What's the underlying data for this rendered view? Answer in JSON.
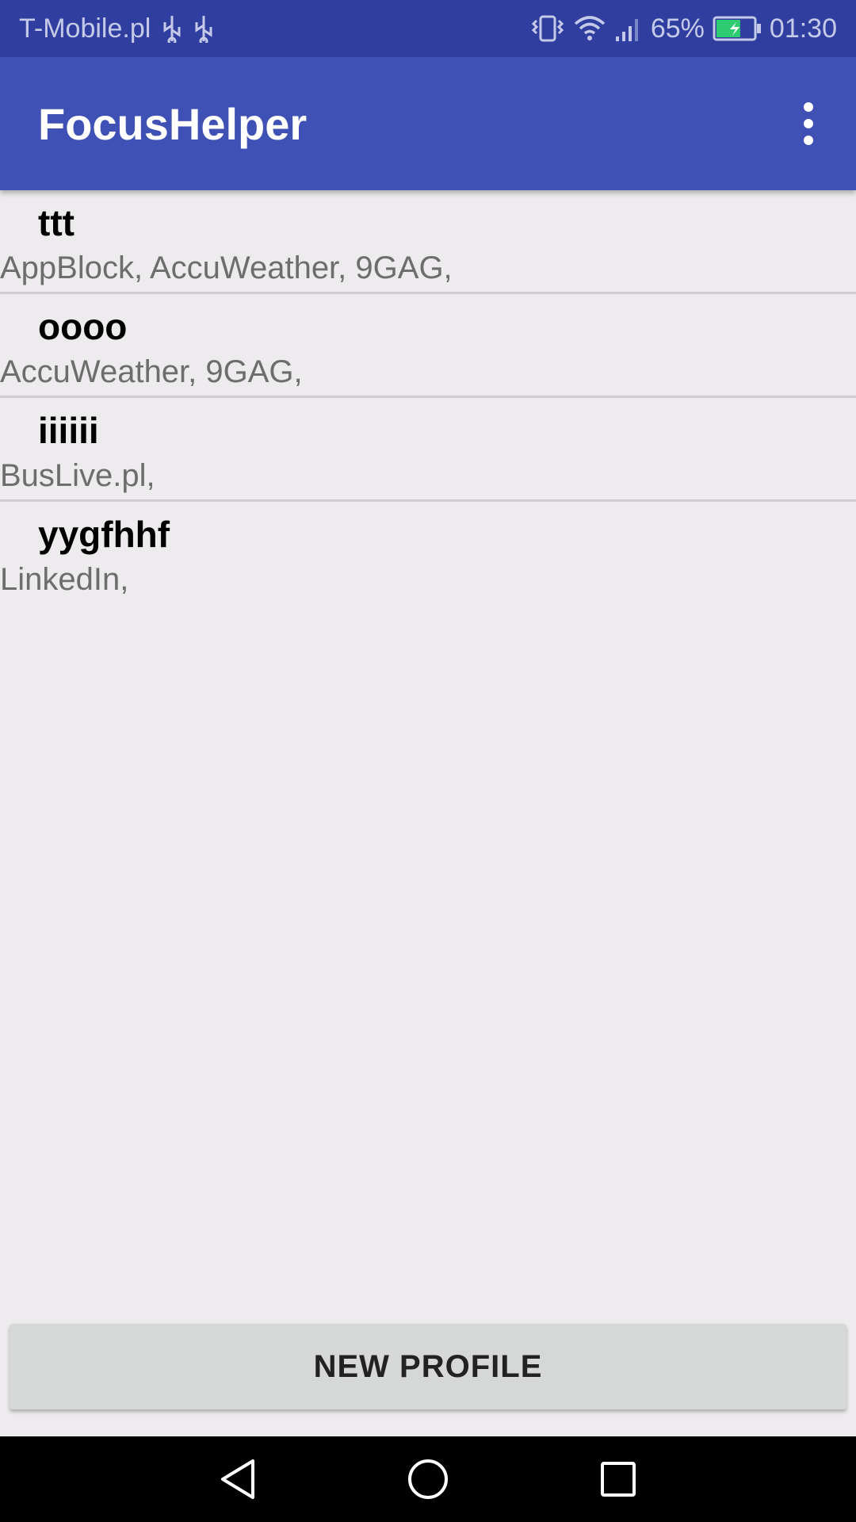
{
  "status_bar": {
    "carrier": "T-Mobile.pl",
    "battery_percent": "65%",
    "time": "01:30",
    "icons": [
      "usb-icon",
      "usb-icon",
      "vibrate-icon",
      "wifi-icon",
      "signal-icon",
      "battery-charging-icon"
    ],
    "battery_level": 0.65
  },
  "app_bar": {
    "title": "FocusHelper",
    "menu_icon": "more-vert-icon"
  },
  "profiles": [
    {
      "name": "ttt",
      "apps": "AppBlock, AccuWeather, 9GAG,"
    },
    {
      "name": "oooo",
      "apps": "AccuWeather, 9GAG,"
    },
    {
      "name": "iiiiii",
      "apps": "BusLive.pl,"
    },
    {
      "name": "yygfhhf",
      "apps": "LinkedIn,"
    }
  ],
  "new_profile_button": {
    "label": "NEW PROFILE"
  },
  "nav_bar": {
    "buttons": [
      "back-icon",
      "home-icon",
      "recents-icon"
    ]
  },
  "colors": {
    "primary": "#3f51b5",
    "primary_dark": "#303f9f",
    "background": "#edebed",
    "button": "#d6d7d7"
  }
}
